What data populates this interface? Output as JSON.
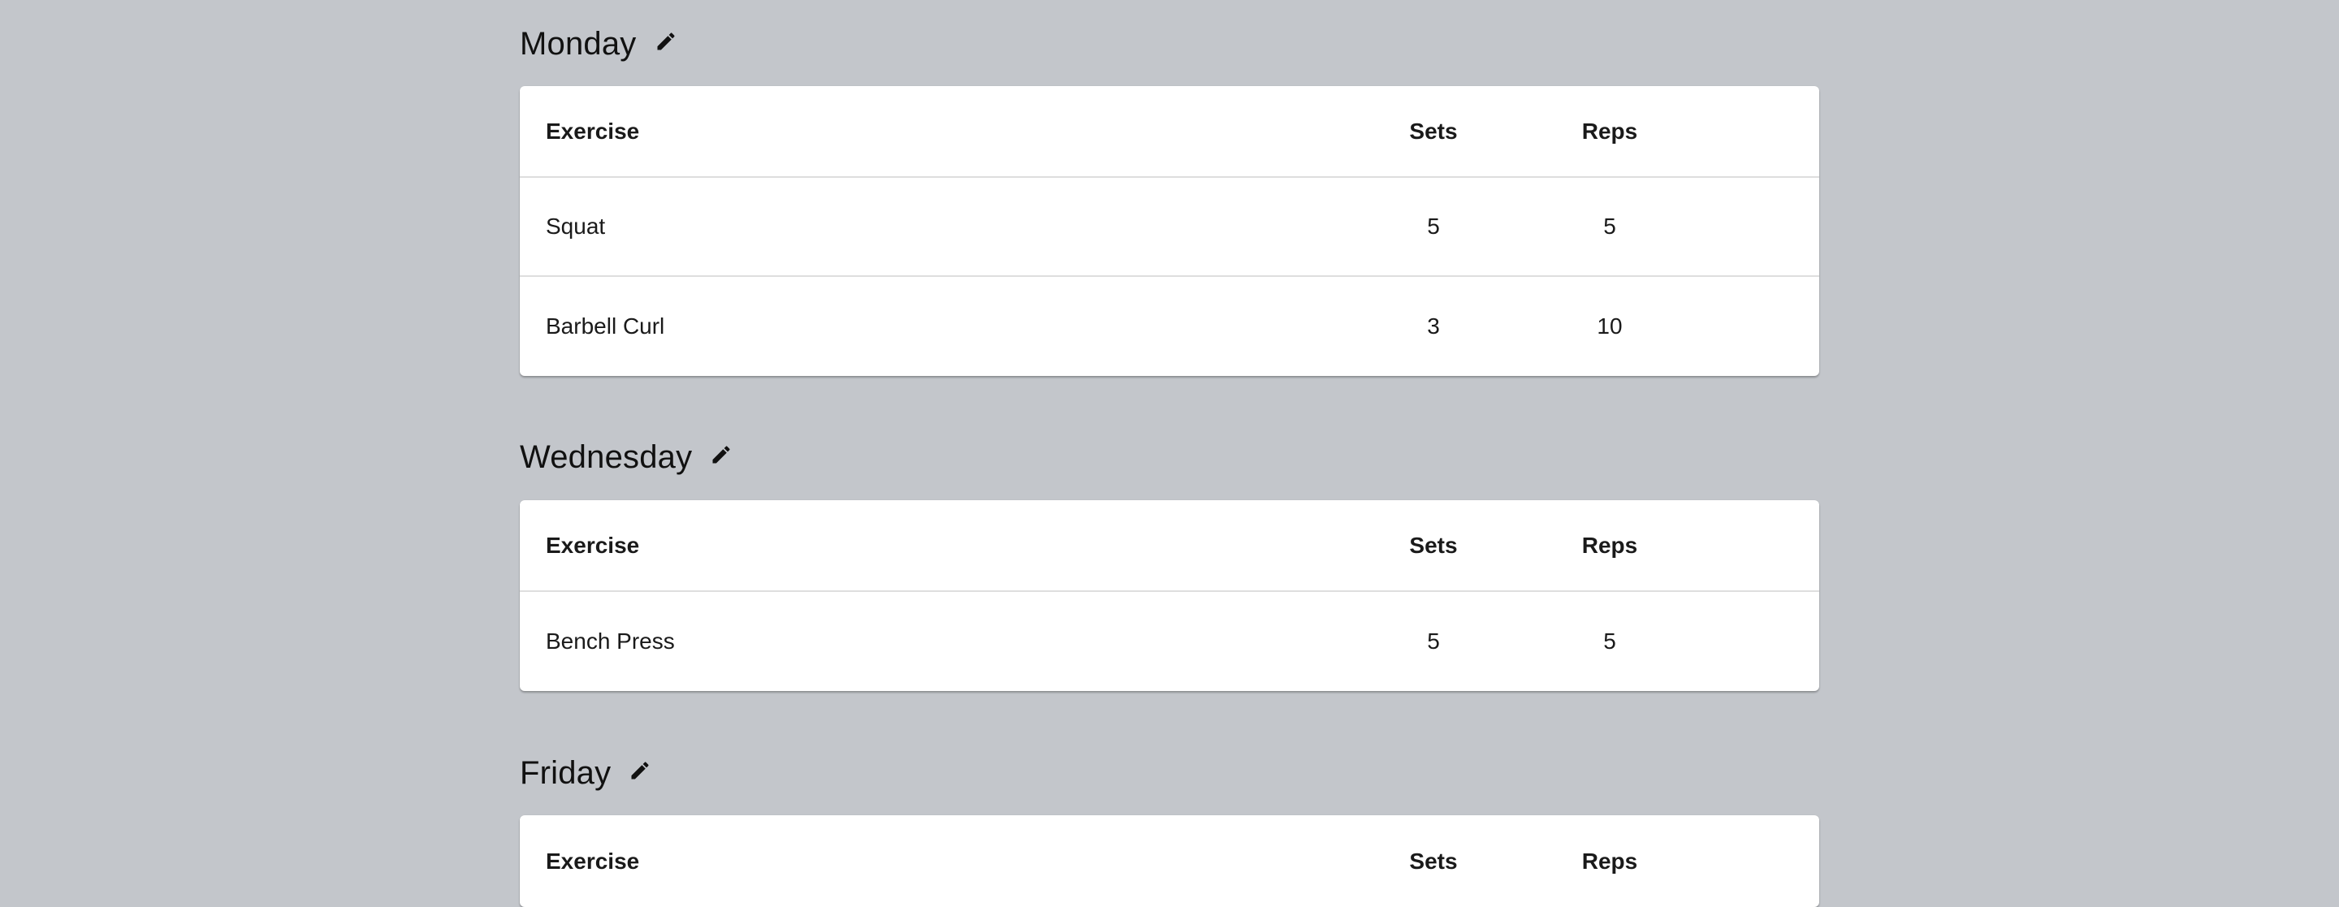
{
  "days": [
    {
      "title": "Monday",
      "columns": [
        "Exercise",
        "Sets",
        "Reps"
      ],
      "rows": [
        [
          "Squat",
          "5",
          "5"
        ],
        [
          "Barbell Curl",
          "3",
          "10"
        ]
      ]
    },
    {
      "title": "Wednesday",
      "columns": [
        "Exercise",
        "Sets",
        "Reps"
      ],
      "rows": [
        [
          "Bench Press",
          "5",
          "5"
        ]
      ]
    },
    {
      "title": "Friday",
      "columns": [
        "Exercise",
        "Sets",
        "Reps"
      ],
      "rows": []
    }
  ],
  "icons": {
    "edit": "pencil-icon"
  },
  "colors": {
    "background": "#c3c6cb",
    "card": "#ffffff",
    "divider": "#dedede"
  }
}
